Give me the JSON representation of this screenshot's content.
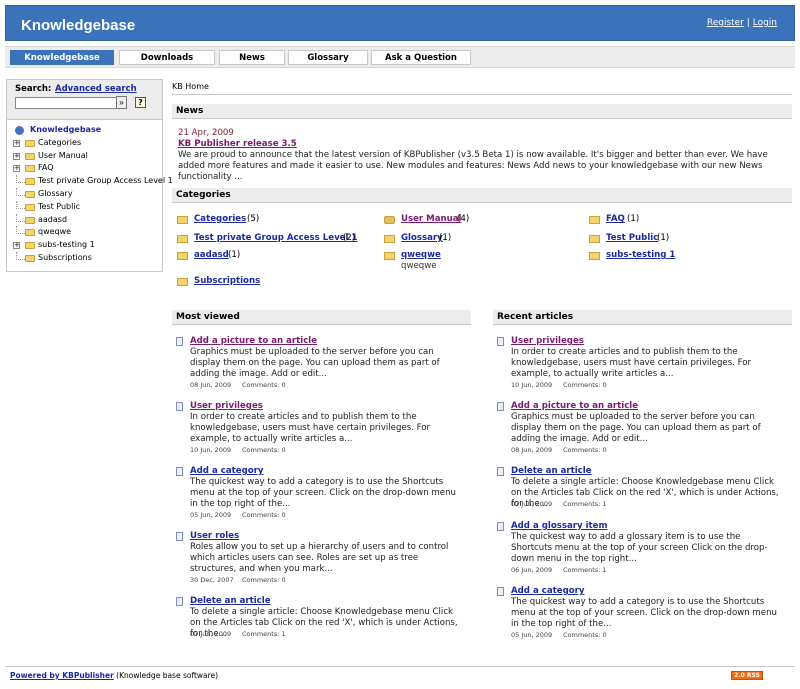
{
  "header": {
    "title": "Knowledgebase",
    "register": "Register",
    "sep": "|",
    "login": "Login"
  },
  "nav": {
    "tabs": [
      "Knowledgebase",
      "Downloads",
      "News",
      "Glossary",
      "Ask a Question"
    ],
    "active": 0
  },
  "search": {
    "label": "Search:",
    "advanced": "Advanced search",
    "go": "»",
    "help": "?"
  },
  "tree": {
    "root": "Knowledgebase",
    "items": [
      {
        "label": "Categories",
        "expandable": true
      },
      {
        "label": "User Manual",
        "expandable": true
      },
      {
        "label": "FAQ",
        "expandable": true
      },
      {
        "label": "Test private Group Access Level 1",
        "expandable": false
      },
      {
        "label": "Glossary",
        "expandable": false
      },
      {
        "label": "Test Public",
        "expandable": false
      },
      {
        "label": "aadasd",
        "expandable": false
      },
      {
        "label": "qweqwe",
        "expandable": false
      },
      {
        "label": "subs-testing 1",
        "expandable": true
      },
      {
        "label": "Subscriptions",
        "expandable": false
      }
    ]
  },
  "breadcrumb": "KB Home",
  "news": {
    "heading": "News",
    "date": "21 Apr, 2009",
    "title": "KB Publisher release 3.5",
    "body": "We are proud to announce that the latest version of KBPublisher (v3.5 Beta 1) is now available. It's bigger and better than ever. We have added more features and made it easier to use. New modules and features: News Add news to your knowledgebase with our new News functionality ..."
  },
  "categories": {
    "heading": "Categories",
    "items": [
      {
        "name": "Categories",
        "count": "(5)"
      },
      {
        "name": "User Manual",
        "count": "(4)"
      },
      {
        "name": "FAQ",
        "count": "(1)"
      },
      {
        "name": "Test private Group Access Level 1",
        "count": "(2)"
      },
      {
        "name": "Glossary",
        "count": "(1)"
      },
      {
        "name": "Test Public",
        "count": "(1)"
      },
      {
        "name": "aadasd",
        "count": "(1)"
      },
      {
        "name": "qweqwe",
        "count": "",
        "sub": "qweqwe"
      },
      {
        "name": "subs-testing 1",
        "count": ""
      },
      {
        "name": "Subscriptions",
        "count": ""
      }
    ]
  },
  "most_viewed": {
    "heading": "Most viewed",
    "articles": [
      {
        "title": "Add a picture to an article",
        "body": "Graphics must be uploaded to the server before you can display them on the page. You can upload them as part of adding the image. Add or edit...",
        "date": "08 Jun, 2009",
        "comments": "Comments: 0"
      },
      {
        "title": "User privileges",
        "body": "In order to create articles and to publish them to the knowledgebase, users must have certain privileges. For example, to actually write articles a...",
        "date": "10 Jun, 2009",
        "comments": "Comments: 0"
      },
      {
        "title": "Add a category",
        "body": "The quickest way to add a category is to use the Shortcuts menu at the top of your screen. Click on the drop-down menu in the top right of the...",
        "date": "05 Jun, 2009",
        "comments": "Comments: 0"
      },
      {
        "title": "User roles",
        "body": "Roles allow you to set up a hierarchy of users and to control which articles users can see. Roles are set up as tree structures, and when you mark...",
        "date": "30 Dec, 2007",
        "comments": "Comments: 0"
      },
      {
        "title": "Delete an article",
        "body": "To delete a single article: Choose Knowledgebase menu Click on the Articles tab Click on the red 'X', which is under Actions, for the...",
        "date": "07 Jun, 2009",
        "comments": "Comments: 1"
      }
    ]
  },
  "recent": {
    "heading": "Recent articles",
    "articles": [
      {
        "title": "User privileges",
        "body": "In order to create articles and to publish them to the knowledgebase, users must have certain privileges. For example, to actually write articles a...",
        "date": "10 Jun, 2009",
        "comments": "Comments: 0"
      },
      {
        "title": "Add a picture to an article",
        "body": "Graphics must be uploaded to the server before you can display them on the page. You can upload them as part of adding the image. Add or edit...",
        "date": "08 Jun, 2009",
        "comments": "Comments: 0"
      },
      {
        "title": "Delete an article",
        "body": "To delete a single article: Choose Knowledgebase menu Click on the Articles tab Click on the red 'X', which is under Actions, for the...",
        "date": "07 Jun, 2009",
        "comments": "Comments: 1"
      },
      {
        "title": "Add a glossary item",
        "body": "The quickest way to add a glossary item is to use the Shortcuts menu at the top of your screen Click on the drop-down menu in the top right...",
        "date": "06 Jun, 2009",
        "comments": "Comments: 1"
      },
      {
        "title": "Add a category",
        "body": "The quickest way to add a category is to use the Shortcuts menu at the top of your screen. Click on the drop-down menu in the top right of the...",
        "date": "05 Jun, 2009",
        "comments": "Comments: 0"
      }
    ]
  },
  "footer": {
    "link": "Powered by KBPublisher",
    "text": " (Knowledge base software)",
    "rss": "2.0 RSS"
  },
  "colors": {
    "header_bg": "#3a73ba",
    "link": "#1c2a9c",
    "visited": "#7a1a70"
  },
  "icons": {
    "folder": "folder-icon",
    "doc": "document-icon",
    "rss": "rss-icon"
  }
}
